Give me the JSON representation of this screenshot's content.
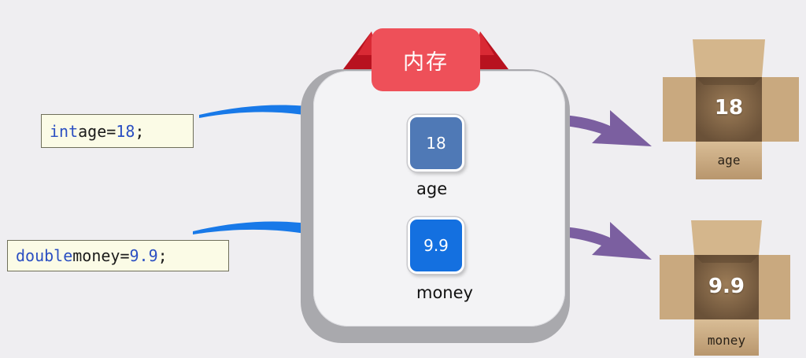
{
  "memory": {
    "title": "内存"
  },
  "code_lines": [
    {
      "keyword": "int",
      "name": "age",
      "operator": "=",
      "value": "18",
      "terminator": ";"
    },
    {
      "keyword": "double",
      "name": "money",
      "operator": "=",
      "value": "9.9",
      "terminator": ";"
    }
  ],
  "cells": [
    {
      "value": "18",
      "name": "age",
      "color": "#4f79b6"
    },
    {
      "value": "9.9",
      "name": "money",
      "color": "#1470e0"
    }
  ],
  "boxes": [
    {
      "value": "18",
      "name": "age"
    },
    {
      "value": "9.9",
      "name": "money"
    }
  ],
  "colors": {
    "arrow_in": "#1879e8",
    "arrow_out": "#7b5fa0",
    "memory_label": "#ee5059",
    "ribbon": "#c8202c",
    "cardboard": "#c8a77e"
  }
}
